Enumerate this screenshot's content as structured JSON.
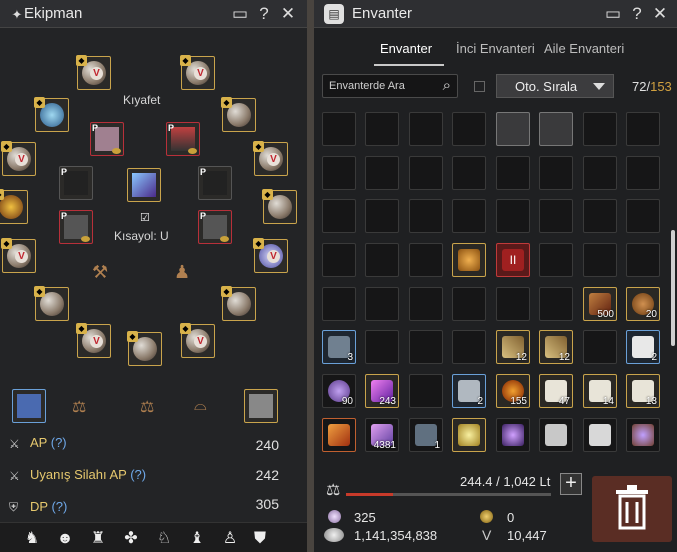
{
  "equipment_window": {
    "title": "Ekipman",
    "costume_label": "Kıyafet",
    "shortcut_label": "Kısayol: U",
    "stats": [
      {
        "name": "AP",
        "help": "(?)",
        "value": "240"
      },
      {
        "name": "Uyanış Silahı AP",
        "help": "(?)",
        "value": "242"
      },
      {
        "name": "DP",
        "help": "(?)",
        "value": "305"
      }
    ],
    "slot_marker": "V",
    "pearl_marker": "P"
  },
  "inventory_window": {
    "title": "Envanter",
    "tabs": [
      "Envanter",
      "İnci Envanteri",
      "Aile Envanteri"
    ],
    "active_tab": "Envanter",
    "search_placeholder": "Envanterde Ara",
    "sort_label": "Oto. Sırala",
    "slots_used": "72",
    "slots_total": "153",
    "weight_text": "244.4 / 1,042 Lt",
    "weight_fill_fraction": 0.23,
    "currencies": {
      "loyalty": "325",
      "silver": "1,141,354,838",
      "gold_coin": "0",
      "value_pack": "10,447"
    },
    "item_counts": [
      "3",
      "12",
      "12",
      "2",
      "90",
      "243",
      "2",
      "155",
      "47",
      "14",
      "13",
      "4381",
      "1",
      "500",
      "20"
    ]
  },
  "colors": {
    "gold_border": "#c9a44c",
    "red_border": "#b8303a",
    "blue_border": "#6aa0d8",
    "help_blue": "#6fa8e8",
    "stat_gold": "#e6c86e",
    "trash_bg": "#5a2d24"
  }
}
